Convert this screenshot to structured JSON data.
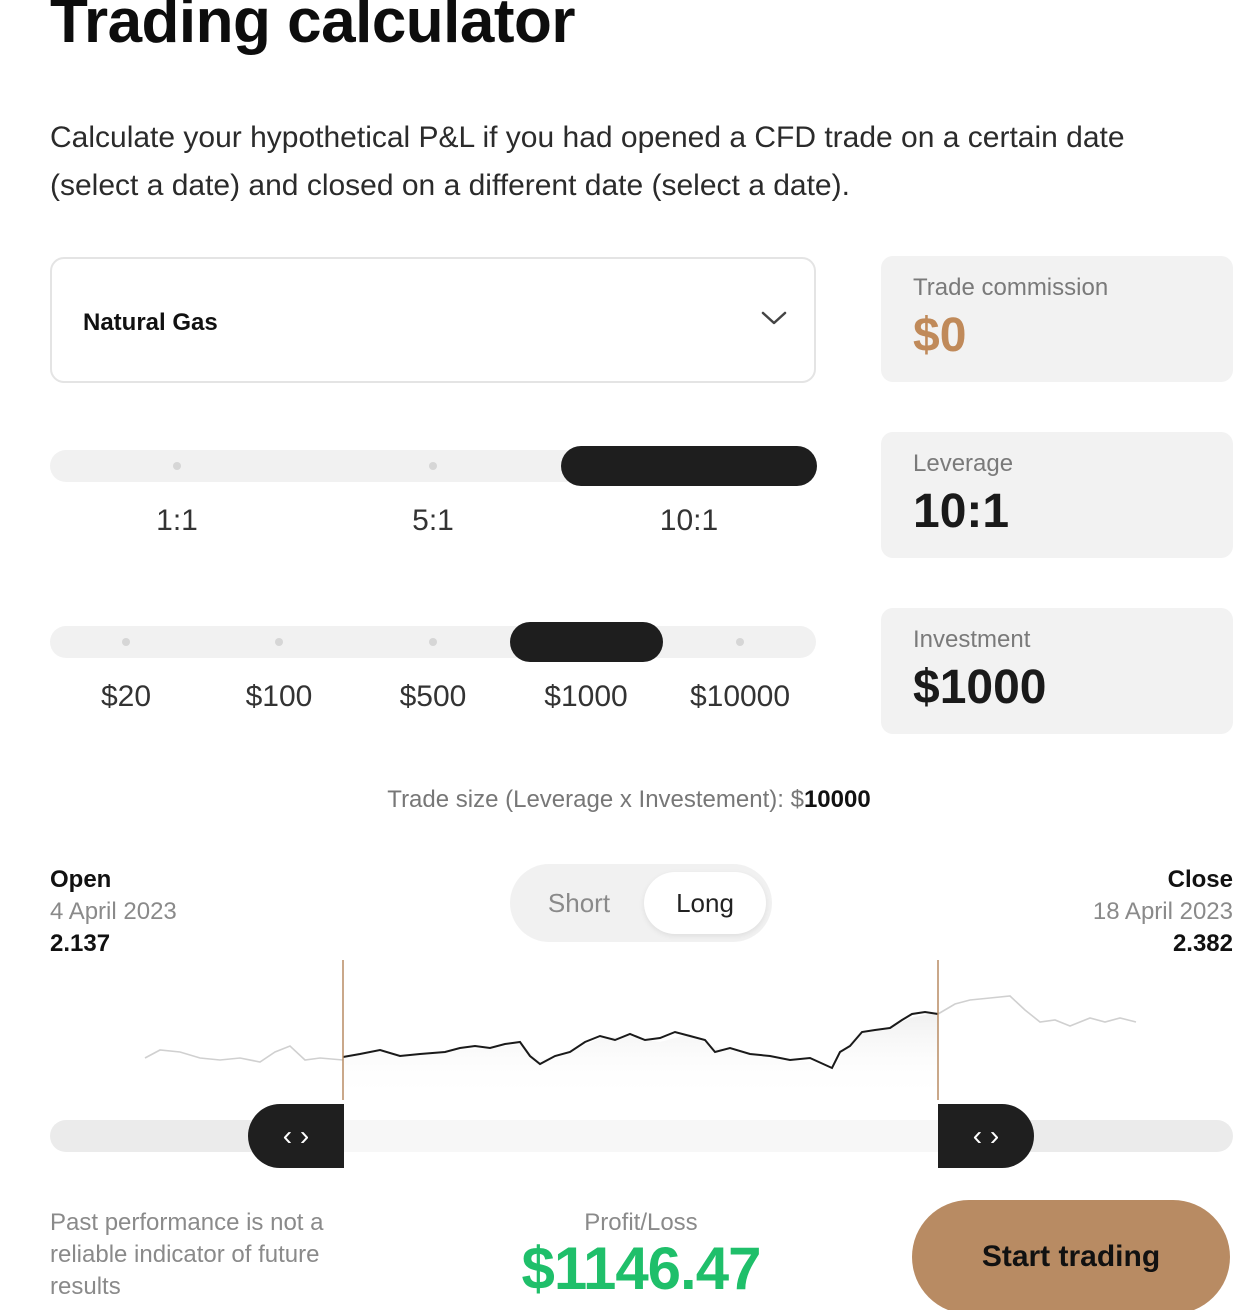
{
  "page": {
    "title": "Trading calculator",
    "intro": "Calculate your hypothetical P&L if you had opened a CFD trade on a certain date (select a date) and closed on a different date (select a date)."
  },
  "instrument": {
    "selected": "Natural Gas",
    "icon": "chevron-down-icon"
  },
  "leverage_slider": {
    "options": [
      "1:1",
      "5:1",
      "10:1"
    ],
    "selected": "10:1"
  },
  "investment_slider": {
    "options": [
      "$20",
      "$100",
      "$500",
      "$1000",
      "$10000"
    ],
    "selected": "$1000"
  },
  "cards": {
    "commission": {
      "label": "Trade commission",
      "value": "$0"
    },
    "leverage": {
      "label": "Leverage",
      "value": "10:1"
    },
    "investment": {
      "label": "Investment",
      "value": "$1000"
    }
  },
  "trade_size": {
    "label": "Trade size (Leverage x Investement): $",
    "value": "10000"
  },
  "open": {
    "heading": "Open",
    "date": "4 April 2023",
    "price": "2.137"
  },
  "close": {
    "heading": "Close",
    "date": "18 April 2023",
    "price": "2.382"
  },
  "direction": {
    "options": [
      "Short",
      "Long"
    ],
    "selected": "Long"
  },
  "range_handles": {
    "left_glyph": "‹ ›",
    "right_glyph": "‹ ›"
  },
  "disclaimer": "Past performance is not a reliable indicator of future results",
  "profit_loss": {
    "label": "Profit/Loss",
    "value": "$1146.47"
  },
  "cta": {
    "label": "Start trading"
  },
  "colors": {
    "accent": "#c08a5a",
    "button": "#b88b63",
    "profit": "#1fbf6a",
    "dark": "#1e1e1e"
  }
}
